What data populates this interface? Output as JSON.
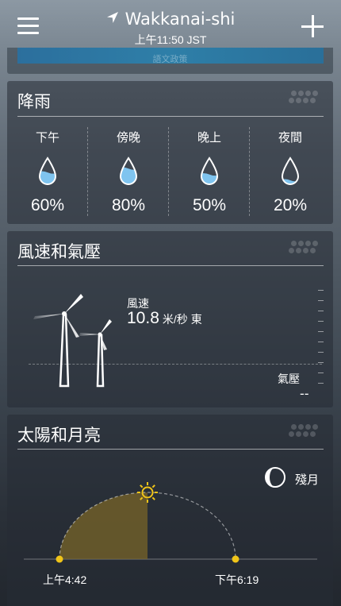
{
  "header": {
    "city": "Wakkanai-shi",
    "local_time": "上午11:50 JST"
  },
  "prev_card": {
    "ghost_text": "語文政策"
  },
  "precipitation": {
    "title": "降雨",
    "periods": [
      {
        "label": "下午",
        "percent": "60%",
        "fill": 0.6
      },
      {
        "label": "傍晚",
        "percent": "80%",
        "fill": 0.8
      },
      {
        "label": "晚上",
        "percent": "50%",
        "fill": 0.5
      },
      {
        "label": "夜間",
        "percent": "20%",
        "fill": 0.2
      }
    ],
    "drop_color": "#7fc4ef"
  },
  "wind_pressure": {
    "title": "風速和氣壓",
    "wind_label": "風速",
    "wind_speed": "10.8",
    "wind_unit": "米/秒",
    "wind_direction": "東",
    "pressure_label": "氣壓",
    "pressure_value": "--"
  },
  "sun_moon": {
    "title": "太陽和月亮",
    "sunrise": "上午4:42",
    "sunset": "下午6:19",
    "moon_phase": "殘月",
    "day_progress": 0.5,
    "sun_color": "#f0c419"
  },
  "icons": {
    "menu": "hamburger-menu-icon",
    "location": "location-arrow-icon",
    "add": "plus-icon",
    "drop": "raindrop-icon",
    "sun": "sun-icon",
    "moon": "waning-moon-icon",
    "turbine": "wind-turbine-icon"
  }
}
